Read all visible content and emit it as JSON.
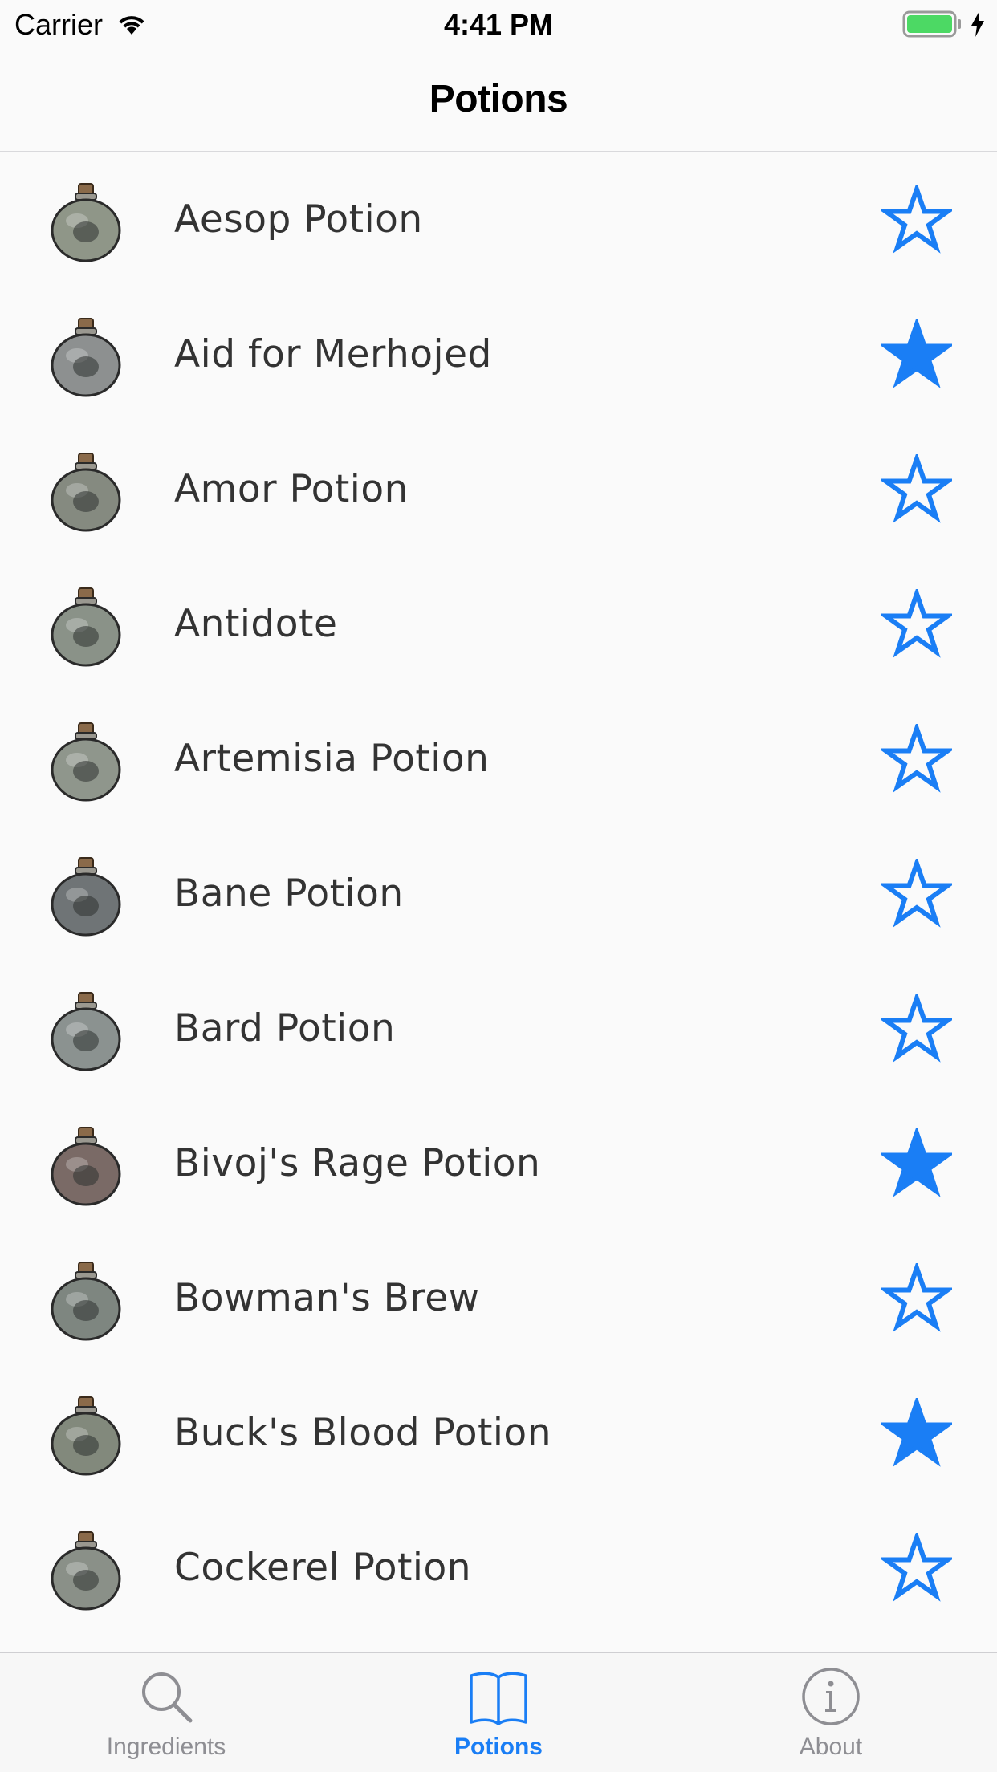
{
  "status_bar": {
    "carrier": "Carrier",
    "time": "4:41 PM"
  },
  "nav": {
    "title": "Potions"
  },
  "accent_color": "#1a7ef5",
  "potions": [
    {
      "name": "Aesop Potion",
      "favorite": false,
      "icon": "potion-bottle-fox-icon"
    },
    {
      "name": "Aid for Merhojed",
      "favorite": true,
      "icon": "potion-bottle-plain-icon"
    },
    {
      "name": "Amor Potion",
      "favorite": false,
      "icon": "potion-bottle-flower-icon"
    },
    {
      "name": "Antidote",
      "favorite": false,
      "icon": "potion-bottle-star-icon"
    },
    {
      "name": "Artemisia Potion",
      "favorite": false,
      "icon": "potion-bottle-circles-icon"
    },
    {
      "name": "Bane Potion",
      "favorite": false,
      "icon": "potion-bottle-hook-icon"
    },
    {
      "name": "Bard Potion",
      "favorite": false,
      "icon": "potion-bottle-bird-icon"
    },
    {
      "name": "Bivoj's Rage Potion",
      "favorite": true,
      "icon": "potion-bottle-heart-icon"
    },
    {
      "name": "Bowman's Brew",
      "favorite": false,
      "icon": "potion-bottle-antler-icon"
    },
    {
      "name": "Buck's Blood Potion",
      "favorite": true,
      "icon": "potion-bottle-sun-icon"
    },
    {
      "name": "Cockerel Potion",
      "favorite": false,
      "icon": "potion-bottle-moth-icon"
    }
  ],
  "tabs": [
    {
      "label": "Ingredients",
      "icon": "search-icon",
      "active": false
    },
    {
      "label": "Potions",
      "icon": "book-icon",
      "active": true
    },
    {
      "label": "About",
      "icon": "info-icon",
      "active": false
    }
  ]
}
